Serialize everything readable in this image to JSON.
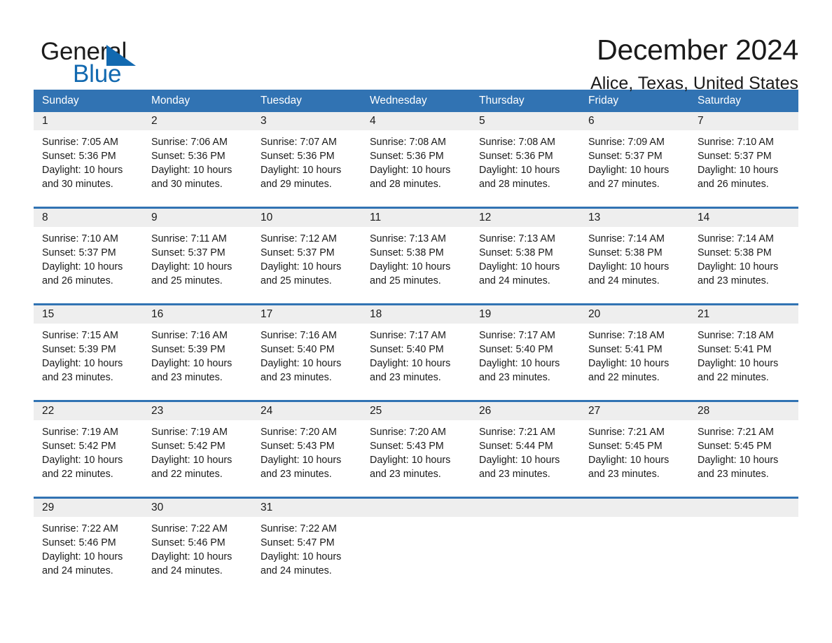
{
  "brand": {
    "name_part1": "General",
    "name_part2": "Blue",
    "triangle_color": "#1269b0",
    "blue_color": "#1269b0"
  },
  "header": {
    "month_title": "December 2024",
    "location": "Alice, Texas, United States"
  },
  "colors": {
    "header_blue": "#3173b3",
    "day_band_gray": "#eeeeee",
    "text": "#1a1a1a",
    "page_background": "#ffffff"
  },
  "weekdays": [
    "Sunday",
    "Monday",
    "Tuesday",
    "Wednesday",
    "Thursday",
    "Friday",
    "Saturday"
  ],
  "labels": {
    "sunrise_prefix": "Sunrise:",
    "sunset_prefix": "Sunset:",
    "daylight_prefix": "Daylight:"
  },
  "weeks": [
    [
      {
        "day": "1",
        "sunrise": "Sunrise: 7:05 AM",
        "sunset": "Sunset: 5:36 PM",
        "daylight_l1": "Daylight: 10 hours",
        "daylight_l2": "and 30 minutes."
      },
      {
        "day": "2",
        "sunrise": "Sunrise: 7:06 AM",
        "sunset": "Sunset: 5:36 PM",
        "daylight_l1": "Daylight: 10 hours",
        "daylight_l2": "and 30 minutes."
      },
      {
        "day": "3",
        "sunrise": "Sunrise: 7:07 AM",
        "sunset": "Sunset: 5:36 PM",
        "daylight_l1": "Daylight: 10 hours",
        "daylight_l2": "and 29 minutes."
      },
      {
        "day": "4",
        "sunrise": "Sunrise: 7:08 AM",
        "sunset": "Sunset: 5:36 PM",
        "daylight_l1": "Daylight: 10 hours",
        "daylight_l2": "and 28 minutes."
      },
      {
        "day": "5",
        "sunrise": "Sunrise: 7:08 AM",
        "sunset": "Sunset: 5:36 PM",
        "daylight_l1": "Daylight: 10 hours",
        "daylight_l2": "and 28 minutes."
      },
      {
        "day": "6",
        "sunrise": "Sunrise: 7:09 AM",
        "sunset": "Sunset: 5:37 PM",
        "daylight_l1": "Daylight: 10 hours",
        "daylight_l2": "and 27 minutes."
      },
      {
        "day": "7",
        "sunrise": "Sunrise: 7:10 AM",
        "sunset": "Sunset: 5:37 PM",
        "daylight_l1": "Daylight: 10 hours",
        "daylight_l2": "and 26 minutes."
      }
    ],
    [
      {
        "day": "8",
        "sunrise": "Sunrise: 7:10 AM",
        "sunset": "Sunset: 5:37 PM",
        "daylight_l1": "Daylight: 10 hours",
        "daylight_l2": "and 26 minutes."
      },
      {
        "day": "9",
        "sunrise": "Sunrise: 7:11 AM",
        "sunset": "Sunset: 5:37 PM",
        "daylight_l1": "Daylight: 10 hours",
        "daylight_l2": "and 25 minutes."
      },
      {
        "day": "10",
        "sunrise": "Sunrise: 7:12 AM",
        "sunset": "Sunset: 5:37 PM",
        "daylight_l1": "Daylight: 10 hours",
        "daylight_l2": "and 25 minutes."
      },
      {
        "day": "11",
        "sunrise": "Sunrise: 7:13 AM",
        "sunset": "Sunset: 5:38 PM",
        "daylight_l1": "Daylight: 10 hours",
        "daylight_l2": "and 25 minutes."
      },
      {
        "day": "12",
        "sunrise": "Sunrise: 7:13 AM",
        "sunset": "Sunset: 5:38 PM",
        "daylight_l1": "Daylight: 10 hours",
        "daylight_l2": "and 24 minutes."
      },
      {
        "day": "13",
        "sunrise": "Sunrise: 7:14 AM",
        "sunset": "Sunset: 5:38 PM",
        "daylight_l1": "Daylight: 10 hours",
        "daylight_l2": "and 24 minutes."
      },
      {
        "day": "14",
        "sunrise": "Sunrise: 7:14 AM",
        "sunset": "Sunset: 5:38 PM",
        "daylight_l1": "Daylight: 10 hours",
        "daylight_l2": "and 23 minutes."
      }
    ],
    [
      {
        "day": "15",
        "sunrise": "Sunrise: 7:15 AM",
        "sunset": "Sunset: 5:39 PM",
        "daylight_l1": "Daylight: 10 hours",
        "daylight_l2": "and 23 minutes."
      },
      {
        "day": "16",
        "sunrise": "Sunrise: 7:16 AM",
        "sunset": "Sunset: 5:39 PM",
        "daylight_l1": "Daylight: 10 hours",
        "daylight_l2": "and 23 minutes."
      },
      {
        "day": "17",
        "sunrise": "Sunrise: 7:16 AM",
        "sunset": "Sunset: 5:40 PM",
        "daylight_l1": "Daylight: 10 hours",
        "daylight_l2": "and 23 minutes."
      },
      {
        "day": "18",
        "sunrise": "Sunrise: 7:17 AM",
        "sunset": "Sunset: 5:40 PM",
        "daylight_l1": "Daylight: 10 hours",
        "daylight_l2": "and 23 minutes."
      },
      {
        "day": "19",
        "sunrise": "Sunrise: 7:17 AM",
        "sunset": "Sunset: 5:40 PM",
        "daylight_l1": "Daylight: 10 hours",
        "daylight_l2": "and 23 minutes."
      },
      {
        "day": "20",
        "sunrise": "Sunrise: 7:18 AM",
        "sunset": "Sunset: 5:41 PM",
        "daylight_l1": "Daylight: 10 hours",
        "daylight_l2": "and 22 minutes."
      },
      {
        "day": "21",
        "sunrise": "Sunrise: 7:18 AM",
        "sunset": "Sunset: 5:41 PM",
        "daylight_l1": "Daylight: 10 hours",
        "daylight_l2": "and 22 minutes."
      }
    ],
    [
      {
        "day": "22",
        "sunrise": "Sunrise: 7:19 AM",
        "sunset": "Sunset: 5:42 PM",
        "daylight_l1": "Daylight: 10 hours",
        "daylight_l2": "and 22 minutes."
      },
      {
        "day": "23",
        "sunrise": "Sunrise: 7:19 AM",
        "sunset": "Sunset: 5:42 PM",
        "daylight_l1": "Daylight: 10 hours",
        "daylight_l2": "and 22 minutes."
      },
      {
        "day": "24",
        "sunrise": "Sunrise: 7:20 AM",
        "sunset": "Sunset: 5:43 PM",
        "daylight_l1": "Daylight: 10 hours",
        "daylight_l2": "and 23 minutes."
      },
      {
        "day": "25",
        "sunrise": "Sunrise: 7:20 AM",
        "sunset": "Sunset: 5:43 PM",
        "daylight_l1": "Daylight: 10 hours",
        "daylight_l2": "and 23 minutes."
      },
      {
        "day": "26",
        "sunrise": "Sunrise: 7:21 AM",
        "sunset": "Sunset: 5:44 PM",
        "daylight_l1": "Daylight: 10 hours",
        "daylight_l2": "and 23 minutes."
      },
      {
        "day": "27",
        "sunrise": "Sunrise: 7:21 AM",
        "sunset": "Sunset: 5:45 PM",
        "daylight_l1": "Daylight: 10 hours",
        "daylight_l2": "and 23 minutes."
      },
      {
        "day": "28",
        "sunrise": "Sunrise: 7:21 AM",
        "sunset": "Sunset: 5:45 PM",
        "daylight_l1": "Daylight: 10 hours",
        "daylight_l2": "and 23 minutes."
      }
    ],
    [
      {
        "day": "29",
        "sunrise": "Sunrise: 7:22 AM",
        "sunset": "Sunset: 5:46 PM",
        "daylight_l1": "Daylight: 10 hours",
        "daylight_l2": "and 24 minutes."
      },
      {
        "day": "30",
        "sunrise": "Sunrise: 7:22 AM",
        "sunset": "Sunset: 5:46 PM",
        "daylight_l1": "Daylight: 10 hours",
        "daylight_l2": "and 24 minutes."
      },
      {
        "day": "31",
        "sunrise": "Sunrise: 7:22 AM",
        "sunset": "Sunset: 5:47 PM",
        "daylight_l1": "Daylight: 10 hours",
        "daylight_l2": "and 24 minutes."
      },
      {
        "day": "",
        "sunrise": "",
        "sunset": "",
        "daylight_l1": "",
        "daylight_l2": ""
      },
      {
        "day": "",
        "sunrise": "",
        "sunset": "",
        "daylight_l1": "",
        "daylight_l2": ""
      },
      {
        "day": "",
        "sunrise": "",
        "sunset": "",
        "daylight_l1": "",
        "daylight_l2": ""
      },
      {
        "day": "",
        "sunrise": "",
        "sunset": "",
        "daylight_l1": "",
        "daylight_l2": ""
      }
    ]
  ]
}
